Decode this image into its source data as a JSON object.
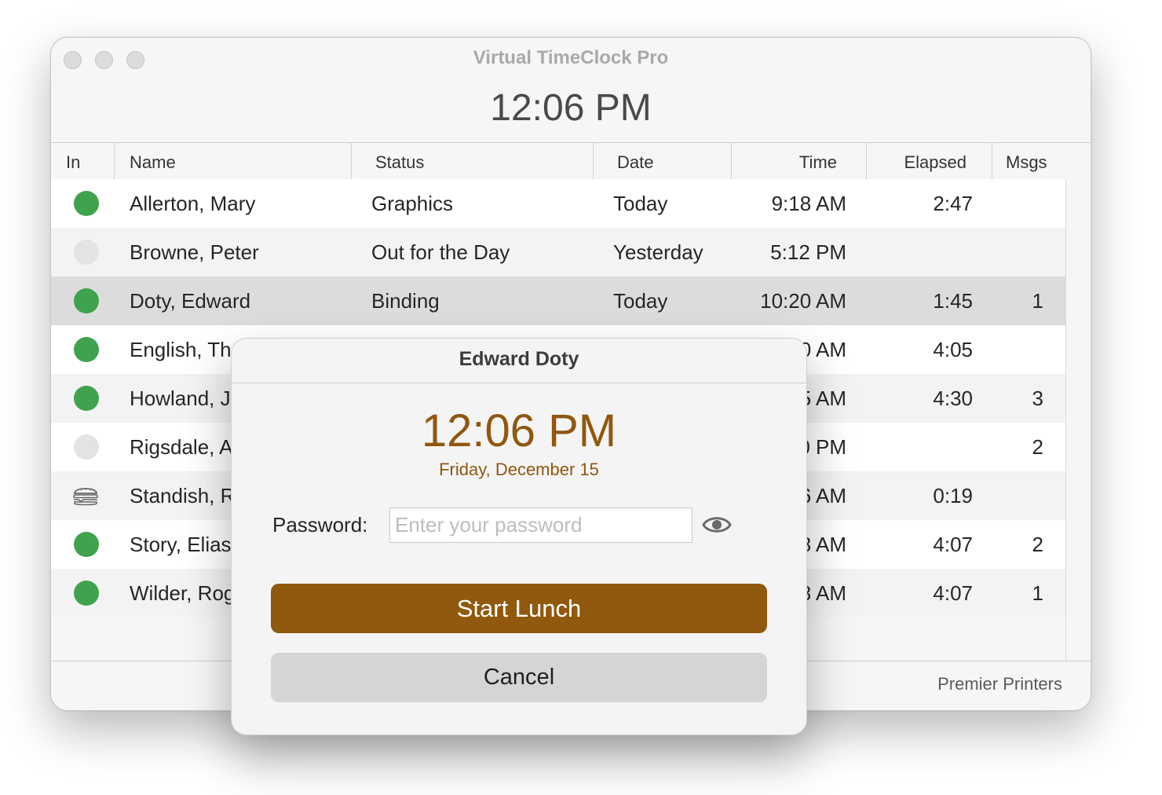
{
  "window": {
    "title": "Virtual TimeClock Pro",
    "clock": "12:06 PM",
    "footer_company": "Premier Printers"
  },
  "table": {
    "columns": [
      "In",
      "Name",
      "Status",
      "Date",
      "Time",
      "Elapsed",
      "Msgs"
    ],
    "rows": [
      {
        "in": "in",
        "name": "Allerton, Mary",
        "status": "Graphics",
        "date": "Today",
        "time": "9:18 AM",
        "elapsed": "2:47",
        "msgs": ""
      },
      {
        "in": "out",
        "name": "Browne, Peter",
        "status": "Out for the Day",
        "date": "Yesterday",
        "time": "5:12 PM",
        "elapsed": "",
        "msgs": ""
      },
      {
        "in": "in",
        "name": "Doty, Edward",
        "status": "Binding",
        "date": "Today",
        "time": "10:20 AM",
        "elapsed": "1:45",
        "msgs": "1"
      },
      {
        "in": "in",
        "name": "English, Th",
        "status": "",
        "date": "",
        "time": "0 AM",
        "elapsed": "4:05",
        "msgs": ""
      },
      {
        "in": "in",
        "name": "Howland, J",
        "status": "",
        "date": "",
        "time": "5 AM",
        "elapsed": "4:30",
        "msgs": "3"
      },
      {
        "in": "out",
        "name": "Rigsdale, A",
        "status": "",
        "date": "",
        "time": "0 PM",
        "elapsed": "",
        "msgs": "2"
      },
      {
        "in": "lunch",
        "name": "Standish, R",
        "status": "",
        "date": "",
        "time": "6 AM",
        "elapsed": "0:19",
        "msgs": ""
      },
      {
        "in": "in",
        "name": "Story, Elias",
        "status": "",
        "date": "",
        "time": "8 AM",
        "elapsed": "4:07",
        "msgs": "2"
      },
      {
        "in": "in",
        "name": "Wilder, Rog",
        "status": "",
        "date": "",
        "time": "8 AM",
        "elapsed": "4:07",
        "msgs": "1"
      }
    ],
    "selected_index": 2,
    "icons": {
      "in": "status-in-icon",
      "out": "status-out-icon",
      "lunch": "lunch-burger-icon"
    },
    "colors": {
      "in": "#3fa34d",
      "out": "#e3e3e3"
    }
  },
  "dialog": {
    "title": "Edward Doty",
    "clock": "12:06 PM",
    "date": "Friday, December 15",
    "password_label": "Password:",
    "password_placeholder": "Enter your password",
    "show_password_icon": "eye-icon",
    "primary_button": "Start Lunch",
    "cancel_button": "Cancel",
    "accent_color": "#91590d"
  }
}
